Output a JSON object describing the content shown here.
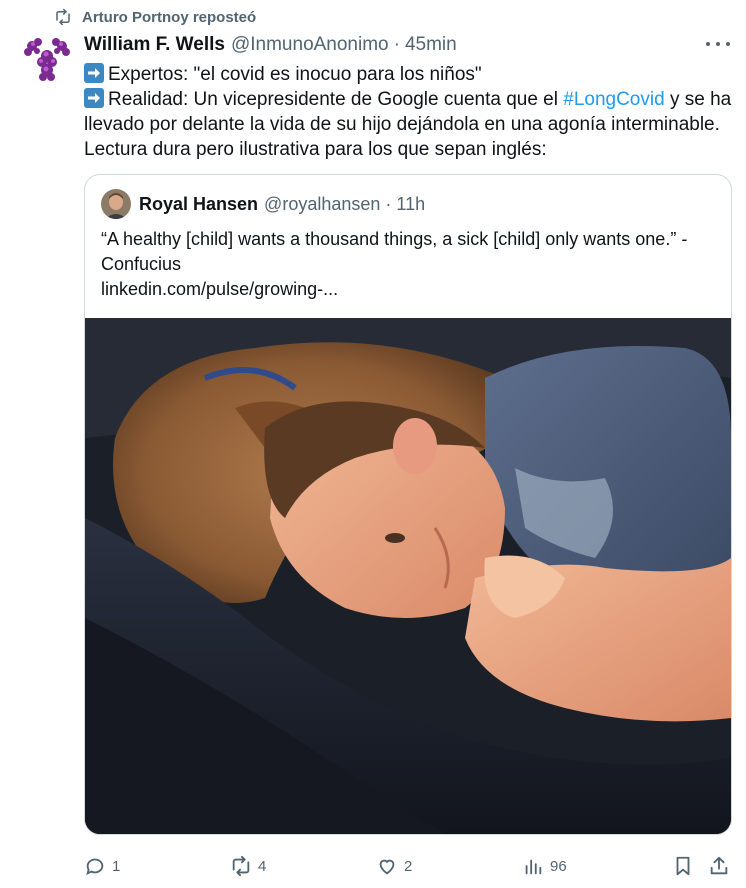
{
  "repost": {
    "text": "Arturo Portnoy reposteó",
    "icon": "repost-icon"
  },
  "tweet": {
    "author_name": "William F. Wells",
    "handle": "@InmunoAnonimo",
    "separator": "·",
    "time": "45min",
    "line1": "Expertos: \"el covid es inocuo para los niños\"",
    "line2_pre": "Realidad: Un vicepresidente de Google cuenta que el ",
    "hashtag": "#LongCovid",
    "line2_post": " y se ha llevado por delante la vida de su hijo dejándola en una agonía interminable. Lectura dura pero ilustrativa para los que sepan inglés:"
  },
  "quote": {
    "author_name": "Royal Hansen",
    "handle": "@royalhansen",
    "separator": "·",
    "time": "11h",
    "text": "“A healthy [child] wants a thousand things, a sick [child] only wants one.” - Confucius",
    "link": "linkedin.com/pulse/growing-..."
  },
  "actions": {
    "reply_count": "1",
    "repost_count": "4",
    "like_count": "2",
    "views_count": "96"
  },
  "colors": {
    "accent": "#1d9bf0",
    "secondary_text": "#536471",
    "border": "#cfd9de",
    "emoji_blue": "#3b88c3"
  }
}
